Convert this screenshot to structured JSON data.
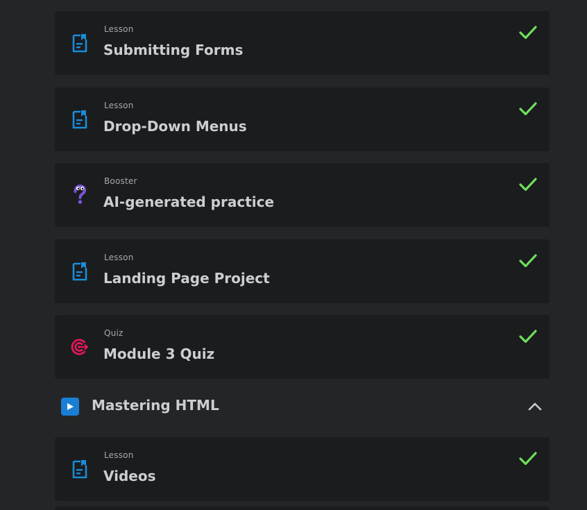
{
  "items": [
    {
      "type": "Lesson",
      "title": "Submitting Forms",
      "icon": "lesson-icon",
      "completed": true
    },
    {
      "type": "Lesson",
      "title": "Drop-Down Menus",
      "icon": "lesson-icon",
      "completed": true
    },
    {
      "type": "Booster",
      "title": "AI-generated practice",
      "icon": "question-mark-icon",
      "completed": true
    },
    {
      "type": "Lesson",
      "title": "Landing Page Project",
      "icon": "lesson-icon",
      "completed": true
    },
    {
      "type": "Quiz",
      "title": "Module 3 Quiz",
      "icon": "target-icon",
      "completed": true
    }
  ],
  "module": {
    "title": "Mastering HTML",
    "icon": "play-icon",
    "expanded": true
  },
  "module_items": [
    {
      "type": "Lesson",
      "title": "Videos",
      "icon": "lesson-icon",
      "completed": true
    }
  ],
  "colors": {
    "background": "#242526",
    "card": "#1b1c1e",
    "check": "#6ee05a",
    "lesson_icon": "#1a8cd8",
    "booster_icon": "#7b52d6",
    "quiz_icon": "#e0195a",
    "module_icon": "#1a7fd4"
  }
}
